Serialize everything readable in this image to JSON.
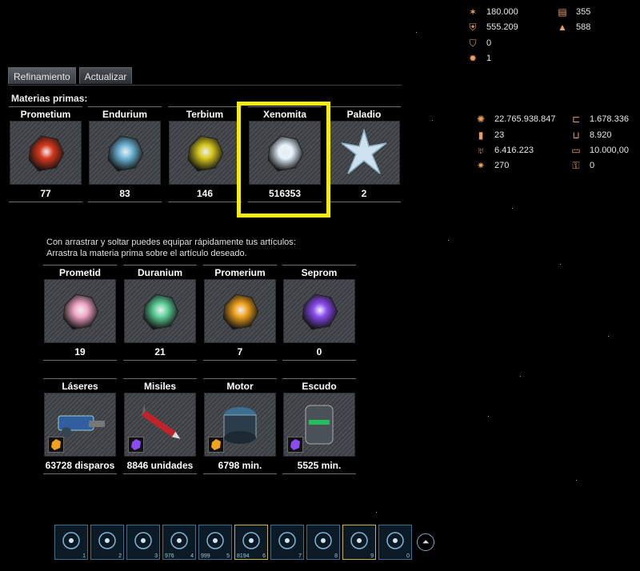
{
  "stats_top": [
    {
      "icon": "rank-icon",
      "value": "180.000"
    },
    {
      "icon": "cargo-icon",
      "value": "355"
    },
    {
      "icon": "shield-icon",
      "value": "555.209"
    },
    {
      "icon": "ship-icon",
      "value": "588"
    },
    {
      "icon": "shield-badge-icon",
      "value": "0"
    },
    {
      "icon": "gear-icon",
      "value": "1"
    }
  ],
  "stats_mid": [
    {
      "icon": "experience-icon",
      "value": "22.765.938.847"
    },
    {
      "icon": "credits-icon",
      "value": "1.678.336"
    },
    {
      "icon": "level-icon",
      "value": "23"
    },
    {
      "icon": "magnet-icon",
      "value": "8.920"
    },
    {
      "icon": "honor-icon",
      "value": "6.416.223"
    },
    {
      "icon": "ammo-icon",
      "value": "10.000,00"
    },
    {
      "icon": "explosion-icon",
      "value": "270"
    },
    {
      "icon": "key-icon",
      "value": "0"
    }
  ],
  "tabs": [
    "Refinamiento",
    "Actualizar"
  ],
  "raw_materials_label": "Materias primas:",
  "raw_materials": [
    {
      "name": "Prometium",
      "value": "77",
      "color": "#d8381c"
    },
    {
      "name": "Endurium",
      "value": "83",
      "color": "#6fb7d8"
    },
    {
      "name": "Terbium",
      "value": "146",
      "color": "#d8c81c"
    },
    {
      "name": "Xenomita",
      "value": "516353",
      "color": "#e6f3ff"
    },
    {
      "name": "Paladio",
      "value": "2",
      "color": "#cde2ee"
    }
  ],
  "help_lines": [
    "Con arrastrar y soltar puedes equipar rápidamente tus artículos:",
    "Arrastra la materia prima sobre el artículo deseado."
  ],
  "refined": [
    {
      "name": "Prometid",
      "value": "19",
      "color": "#f2a7c7"
    },
    {
      "name": "Duranium",
      "value": "21",
      "color": "#5fd39a"
    },
    {
      "name": "Promerium",
      "value": "7",
      "color": "#f2a21c"
    },
    {
      "name": "Seprom",
      "value": "0",
      "color": "#8a4cf0"
    }
  ],
  "equipment": [
    {
      "name": "Láseres",
      "value": "63728 disparos",
      "icon": "laser-icon",
      "badge": "promerium-badge-icon"
    },
    {
      "name": "Misiles",
      "value": "8846 unidades",
      "icon": "rocket-icon",
      "badge": "seprom-badge-icon"
    },
    {
      "name": "Motor",
      "value": "6798 min.",
      "icon": "engine-icon",
      "badge": "promerium-badge-icon"
    },
    {
      "name": "Escudo",
      "value": "5525 min.",
      "icon": "shield-generator-icon",
      "badge": "seprom-badge-icon"
    }
  ],
  "action_bar": [
    {
      "n": "1",
      "q": "",
      "icon": "drone-formation-icon"
    },
    {
      "n": "2",
      "q": "",
      "icon": "target-icon"
    },
    {
      "n": "3",
      "q": "",
      "icon": "mine-icon"
    },
    {
      "n": "4",
      "q": "976",
      "icon": "shield-item-icon"
    },
    {
      "n": "5",
      "q": "999",
      "icon": "rocket-item-icon"
    },
    {
      "n": "6",
      "q": "8194",
      "icon": "laser-ammo-icon"
    },
    {
      "n": "7",
      "q": "",
      "icon": "formation-icon"
    },
    {
      "n": "8",
      "q": "",
      "icon": "formation-icon"
    },
    {
      "n": "9",
      "q": "",
      "icon": "formation-icon"
    },
    {
      "n": "0",
      "q": "",
      "icon": "formation-icon"
    }
  ],
  "expand_icon": "chevron-up-icon"
}
